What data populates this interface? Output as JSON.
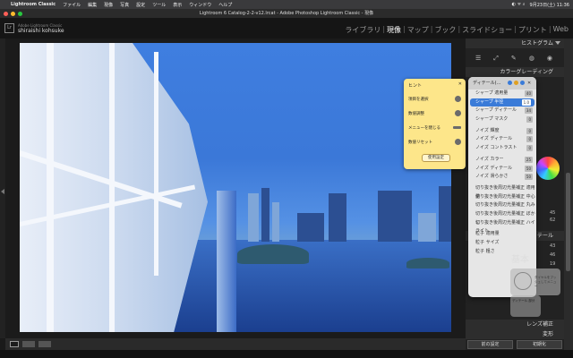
{
  "menubar": {
    "app": "Lightroom Classic",
    "items": [
      "ファイル",
      "編集",
      "現像",
      "写真",
      "設定",
      "ツール",
      "表示",
      "ウィンドウ",
      "ヘルプ"
    ],
    "clock": "9月23日(土) 11:36"
  },
  "titlebar": {
    "title": "Lightroom 6 Catalog-2-2-v12.lrcat - Adobe Photoshop Lightroom Classic - 現像"
  },
  "identity": {
    "logo": "Lr",
    "catalog_label": "Adobe Lightroom Classic",
    "user": "shiraishi kohsuke"
  },
  "modules": {
    "items": [
      {
        "label": "ライブラリ"
      },
      {
        "label": "現像"
      },
      {
        "label": "マップ"
      },
      {
        "label": "ブック"
      },
      {
        "label": "スライドショー"
      },
      {
        "label": "プリント"
      },
      {
        "label": "Web"
      }
    ],
    "sep": "|"
  },
  "right_panel": {
    "histogram": "ヒストグラム",
    "color_grading": "カラーグレーディング",
    "detail": "ディテール",
    "basic": "基本",
    "lens": "レンズ補正",
    "transform": "変形",
    "prev_button": "前の設定",
    "reset_button": "初期化",
    "side_values": [
      "45",
      "62",
      "43",
      "46",
      "19"
    ],
    "tools": [
      "☰",
      "⤢",
      "✎",
      "◍",
      "◉"
    ]
  },
  "hint": {
    "title": "ヒント",
    "close": "✕",
    "rows": [
      "項目を選択",
      "数値調整",
      "メニューを閉じる",
      "数値リセット"
    ],
    "ok_button": "使用設定"
  },
  "menu": {
    "header": "ディテール(...",
    "groups": [
      [
        {
          "label": "シャープ 適用量",
          "value": "40"
        },
        {
          "label": "シャープ 半径",
          "value": "1.0",
          "selected": true
        },
        {
          "label": "シャープ ディテール",
          "value": "34"
        },
        {
          "label": "シャープ マスク",
          "value": "0"
        }
      ],
      [
        {
          "label": "ノイズ 輝度",
          "value": "0"
        },
        {
          "label": "ノイズ ディテール",
          "value": "0"
        },
        {
          "label": "ノイズ コントラスト",
          "value": "0"
        }
      ],
      [
        {
          "label": "ノイズ カラー",
          "value": "25"
        },
        {
          "label": "ノイズ ディテール",
          "value": "50"
        },
        {
          "label": "ノイズ 滑らかさ",
          "value": "50"
        }
      ],
      [
        {
          "label": "切り抜き後周辺光量補正 適用量",
          "value": ""
        },
        {
          "label": "切り抜き後周辺光量補正 中心",
          "value": ""
        },
        {
          "label": "切り抜き後周辺光量補正 丸み",
          "value": ""
        },
        {
          "label": "切り抜き後周辺光量補正 ぼかし",
          "value": ""
        },
        {
          "label": "切り抜き後周辺光量補正 ハイライト",
          "value": ""
        }
      ],
      [
        {
          "label": "粒子 適用量",
          "value": ""
        },
        {
          "label": "粒子 サイズ",
          "value": ""
        },
        {
          "label": "粒子 粗さ",
          "value": ""
        }
      ]
    ]
  },
  "overlay": {
    "dial_text": "ダイヤルをプッシュしてメニュー",
    "dial_text2": "ディテール 部分"
  },
  "colors": {
    "accent": "#3a7bd8",
    "hint_bg": "#fde68a"
  }
}
